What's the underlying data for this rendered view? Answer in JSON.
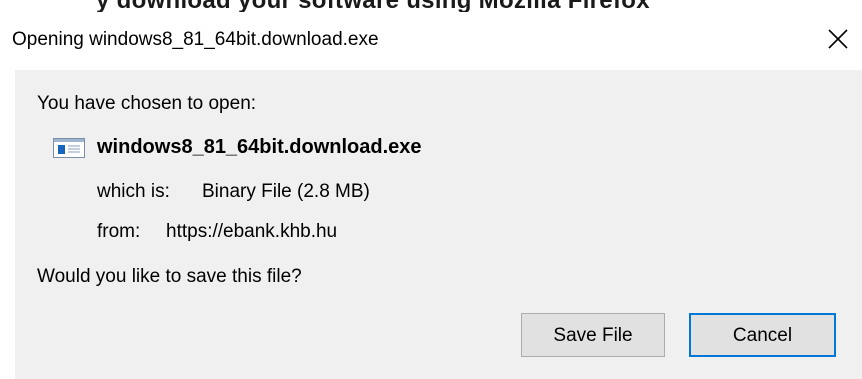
{
  "background_heading": "y download your software using Mozilla Firefox",
  "dialog": {
    "title": "Opening windows8_81_64bit.download.exe",
    "close_icon": "close-icon",
    "chosen_label": "You have chosen to open:",
    "file": {
      "icon": "exe-file-icon",
      "name": "windows8_81_64bit.download.exe",
      "which_is_label": "which is:",
      "which_is_value": "Binary File (2.8 MB)",
      "from_label": "from:",
      "from_value": "https://ebank.khb.hu"
    },
    "question": "Would you like to save this file?",
    "buttons": {
      "save_label": "Save File",
      "cancel_label": "Cancel"
    },
    "colors": {
      "content_background": "#f0f0f0",
      "button_background": "#e1e1e1",
      "focus_border": "#0078d7",
      "icon_blue": "#1565c0"
    }
  }
}
